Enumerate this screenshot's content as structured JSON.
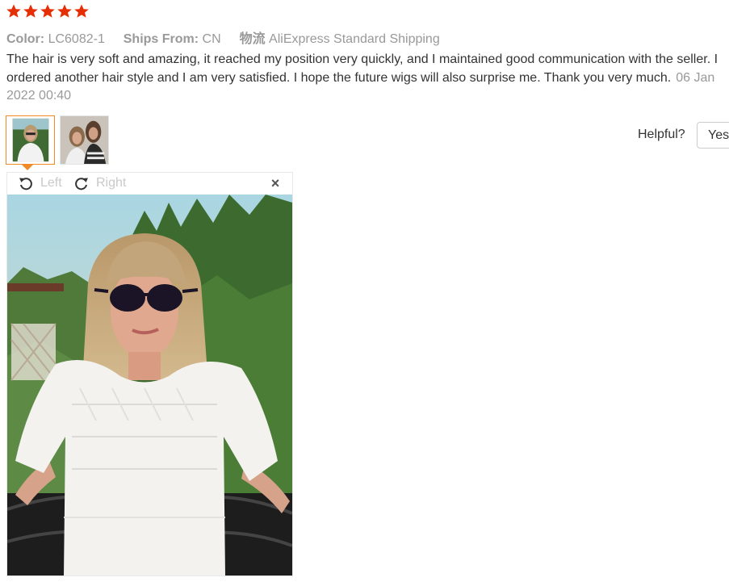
{
  "rating": {
    "stars": 5,
    "color": "#e62e04"
  },
  "meta": {
    "color_label": "Color:",
    "color_value": "LC6082-1",
    "ships_label": "Ships From:",
    "ships_value": "CN",
    "logistics_label": "物流",
    "logistics_value": "AliExpress Standard Shipping"
  },
  "review": {
    "text": "The hair is very soft and amazing, it reached my position very quickly, and I maintained good communication with the seller. I ordered another hair style and I am very satisfied. I hope the future wigs will also surprise me. Thank you very much.",
    "date": "06 Jan 2022 00:40"
  },
  "helpful": {
    "label": "Helpful?",
    "yes_label": "Yes"
  },
  "viewer": {
    "rotate_left_label": "Left",
    "rotate_right_label": "Right",
    "close_glyph": "×"
  },
  "colors": {
    "accent": "#f08a24",
    "muted": "#999999",
    "text": "#333333"
  }
}
